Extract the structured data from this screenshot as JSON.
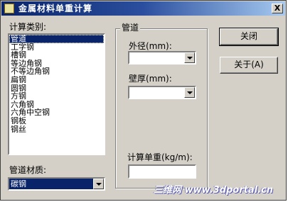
{
  "window": {
    "title": "金属材料单重计算",
    "close_glyph": "X"
  },
  "calc_type": {
    "label": "计算类别:",
    "items": [
      "管道",
      "工字钢",
      "槽钢",
      "等边角钢",
      "不等边角钢",
      "扁钢",
      "圆钢",
      "方钢",
      "六角钢",
      "六角中空钢",
      "钢板",
      "钢丝"
    ],
    "selected_index": 0
  },
  "material": {
    "label": "管道材质:",
    "selected": "碳钢"
  },
  "pipe_group": {
    "title": "管道",
    "outer_diameter_label": "外径(mm):",
    "outer_diameter_value": "",
    "wall_thickness_label": "壁厚(mm):",
    "wall_thickness_value": "",
    "unit_weight_label": "计算单重(kg/m):",
    "unit_weight_value": ""
  },
  "buttons": {
    "close_label": "关闭",
    "about_label": "关于(A)"
  },
  "watermark": {
    "text": "三维网 www.3dportal.cn"
  }
}
